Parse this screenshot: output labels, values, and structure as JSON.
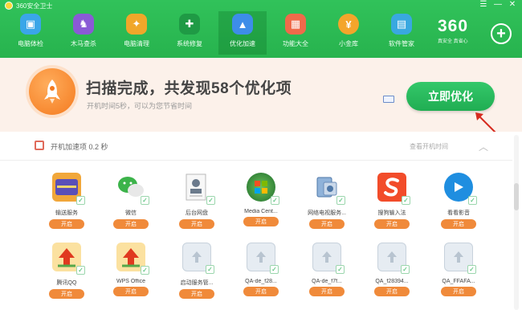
{
  "window": {
    "title": "360安全卫士",
    "controls": [
      "☰",
      "—",
      "✕"
    ]
  },
  "toolbar": {
    "items": [
      {
        "label": "电脑体检",
        "icon": "monitor-icon",
        "color": "#3aa6e8",
        "glyph": "▣"
      },
      {
        "label": "木马查杀",
        "icon": "horse-icon",
        "color": "#8a5ad6",
        "glyph": "♞"
      },
      {
        "label": "电脑清理",
        "icon": "broom-icon",
        "color": "#f0a72a",
        "glyph": "✦"
      },
      {
        "label": "系统修复",
        "icon": "shield-icon",
        "color": "#1f9a45",
        "glyph": "✚"
      },
      {
        "label": "优化加速",
        "icon": "rocket-icon",
        "color": "#3d8de8",
        "glyph": "▲"
      },
      {
        "label": "功能大全",
        "icon": "grid-icon",
        "color": "#ef6a4a",
        "glyph": "▦"
      },
      {
        "label": "小金库",
        "icon": "coin-icon",
        "color": "#f4a52b",
        "glyph": "¥"
      },
      {
        "label": "软件管家",
        "icon": "apps-icon",
        "color": "#39a8e0",
        "glyph": "▤"
      }
    ],
    "brand_number": "360",
    "brand_sub": "真安全 真省心",
    "plus_glyph": "+"
  },
  "banner": {
    "title": "扫描完成，共发现58个优化项",
    "subtitle": "开机时间5秒，可以为您节省时间",
    "button_label": "立即优化"
  },
  "section": {
    "title": "开机加速项 0.2 秒",
    "right_text": "查看开机时间",
    "collapse_glyph": "︿"
  },
  "apps": [
    {
      "name": "输送服务",
      "button": "开启",
      "icon": "card-icon",
      "color": "#f1a73a"
    },
    {
      "name": "微信",
      "button": "开启",
      "icon": "wechat-icon",
      "color": "#ffffff"
    },
    {
      "name": "后台网盘",
      "button": "开启",
      "icon": "contact-icon",
      "color": "#ffffff"
    },
    {
      "name": "Media Cent...",
      "button": "开启",
      "icon": "windows-icon",
      "color": "#2f8a3c"
    },
    {
      "name": "网络电视服务...",
      "button": "开启",
      "icon": "device-icon",
      "color": "#7ba7d8"
    },
    {
      "name": "搜狗输入法",
      "button": "开启",
      "icon": "sogou-icon",
      "color": "#f24c2a"
    },
    {
      "name": "看看影音",
      "button": "开启",
      "icon": "video-icon",
      "color": "#1f8ee0"
    },
    {
      "name": "腾讯QQ",
      "button": "开启",
      "icon": "update-icon",
      "color": "#fbe1a0"
    },
    {
      "name": "WPS Office",
      "button": "开启",
      "icon": "update-icon",
      "color": "#fbe1a0"
    },
    {
      "name": "启动服务管...",
      "button": "开启",
      "icon": "generic-icon",
      "color": "#dfe6ee"
    },
    {
      "name": "QA-de_f28...",
      "button": "开启",
      "icon": "generic-icon",
      "color": "#dfe6ee"
    },
    {
      "name": "QA-de_f7f...",
      "button": "开启",
      "icon": "generic-icon",
      "color": "#dfe6ee"
    },
    {
      "name": "QA_f28394...",
      "button": "开启",
      "icon": "generic-icon",
      "color": "#dfe6ee"
    },
    {
      "name": "QA_FFAFA...",
      "button": "开启",
      "icon": "generic-icon",
      "color": "#dfe6ee"
    }
  ]
}
